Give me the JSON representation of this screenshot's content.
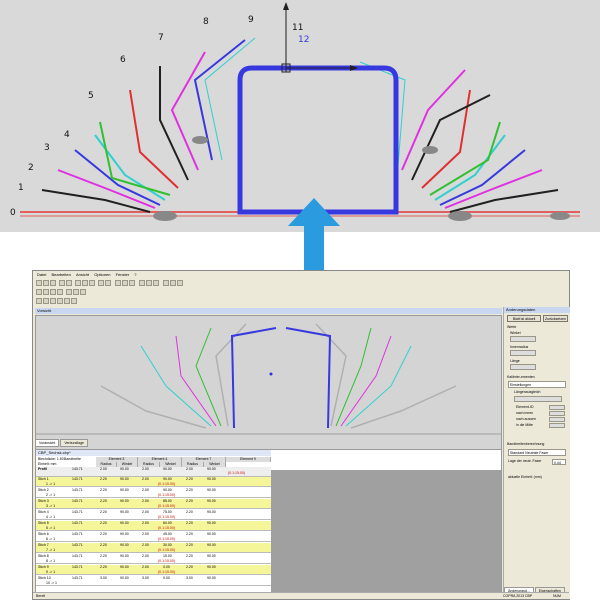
{
  "diagram": {
    "labels": [
      "0",
      "1",
      "2",
      "3",
      "4",
      "5",
      "6",
      "7",
      "8",
      "9",
      "11",
      "12"
    ],
    "colors": {
      "base": "#e06060",
      "blue": "#3838e0",
      "pink": "#e030e0",
      "red": "#e03030",
      "green": "#30c030",
      "cyan": "#30d0d0",
      "black": "#202020",
      "gray": "#b0b0b0"
    }
  },
  "arrow": {
    "color": "#2b9be0"
  },
  "menu": {
    "items": [
      "Datei",
      "Bearbeiten",
      "Ansicht",
      "Optionen",
      "Fenster",
      "?"
    ]
  },
  "preview_title": "Vorsicht",
  "side": {
    "title": "Änderungsdaten",
    "button_main": "Blatt ist aktuell",
    "button_sec": "Zurücksetzen",
    "werte_label": "Werte",
    "winkel_label": "Winkel",
    "innenradius_label": "Innenradius",
    "laenge_label": "Länge",
    "kalibrier_label": "Kalibrier-ementen",
    "einstellungen_value": "Einstellungen",
    "laengenausgleich_label": "Längenausgleich",
    "element_id": "Element-ID",
    "nach_innen": "nach innen",
    "nach_aussen": "nach aussen",
    "in_die_mitte": "in die Mitte",
    "bend_title": "Bandbreitenberechnung",
    "form_value": "Standard Neutrale Faser",
    "lage_label": "Lage der neutr. Faser",
    "lage_value": "0.44",
    "einheit_label": "aktuelle Einheit: (mm)"
  },
  "tabs": [
    "Voransicht",
    "Verbundlage"
  ],
  "table": {
    "file_name": "CBP_Sechsk.cbp*",
    "blechdicke_label": "Blechdicke: 1.50",
    "einheit_label": "Einheit: mm",
    "bandbreite_label": "Bandbreite",
    "profil_label": "Profil",
    "profil_value": "143.71",
    "elements": [
      "Element 3",
      "Element 4",
      "Element 7",
      "Element 9"
    ],
    "radius_label": "Radius",
    "winkel_label": "Winkel",
    "header_values": [
      "2.00",
      "90.00",
      "2.00",
      "90.00",
      "2.00",
      "90.00"
    ],
    "header_red": "(0.1:15.00)",
    "rows": [
      {
        "name": "Stich 1",
        "sub": "1 -> 1",
        "val": "143.71",
        "r1": "2.20",
        "w1": "90.00",
        "r2": "2.00",
        "w2": "90.00",
        "r3": "2.20",
        "w3": "90.00",
        "red": "(0.1:15.00)",
        "yellow": true
      },
      {
        "name": "Stich 2",
        "sub": "2 -> 1",
        "val": "143.71",
        "r1": "2.20",
        "w1": "90.00",
        "r2": "2.00",
        "w2": "90.00",
        "r3": "2.20",
        "w3": "90.00",
        "red": "(0.1:15.00)",
        "yellow": false
      },
      {
        "name": "Stich 3",
        "sub": "3 -> 1",
        "val": "143.71",
        "r1": "2.20",
        "w1": "90.00",
        "r2": "2.00",
        "w2": "85.00",
        "r3": "2.20",
        "w3": "90.00",
        "red": "(0.1:15.00)",
        "yellow": true
      },
      {
        "name": "Stich 4",
        "sub": "4 -> 1",
        "val": "143.71",
        "r1": "2.20",
        "w1": "90.00",
        "r2": "2.00",
        "w2": "75.00",
        "r3": "2.20",
        "w3": "90.00",
        "red": "(0.1:15.00)",
        "yellow": false
      },
      {
        "name": "Stich 5",
        "sub": "5 -> 1",
        "val": "143.71",
        "r1": "2.20",
        "w1": "90.00",
        "r2": "2.00",
        "w2": "60.00",
        "r3": "2.20",
        "w3": "90.00",
        "red": "(0.1:15.00)",
        "yellow": true
      },
      {
        "name": "Stich 6",
        "sub": "6 -> 1",
        "val": "143.71",
        "r1": "2.20",
        "w1": "90.00",
        "r2": "2.00",
        "w2": "45.00",
        "r3": "2.20",
        "w3": "90.00",
        "red": "(0.1:15.00)",
        "yellow": false
      },
      {
        "name": "Stich 7",
        "sub": "7 -> 1",
        "val": "143.71",
        "r1": "2.20",
        "w1": "90.00",
        "r2": "2.00",
        "w2": "30.00",
        "r3": "2.20",
        "w3": "90.00",
        "red": "(0.1:15.00)",
        "yellow": true
      },
      {
        "name": "Stich 8",
        "sub": "8 -> 1",
        "val": "143.71",
        "r1": "2.20",
        "w1": "90.00",
        "r2": "2.00",
        "w2": "15.00",
        "r3": "2.20",
        "w3": "90.00",
        "red": "(0.1:15.00)",
        "yellow": false
      },
      {
        "name": "Stich 9",
        "sub": "9 -> 1",
        "val": "143.71",
        "r1": "2.20",
        "w1": "90.00",
        "r2": "2.00",
        "w2": "0.00",
        "r3": "2.20",
        "w3": "90.00",
        "red": "(0.1:15.00)",
        "yellow": true
      },
      {
        "name": "Stich 10",
        "sub": "10 -> 1",
        "val": "143.71",
        "r1": "3.00",
        "w1": "90.00",
        "r2": "3.00",
        "w2": "0.00",
        "r3": "3.00",
        "w3": "90.00",
        "red": "",
        "yellow": false
      }
    ]
  },
  "bottom_tabs": [
    "Änderungsd...",
    "Eigenschaften"
  ],
  "status": {
    "left": "Bereit",
    "right": "COPRA 2013 CBP",
    "num": "NUM"
  }
}
